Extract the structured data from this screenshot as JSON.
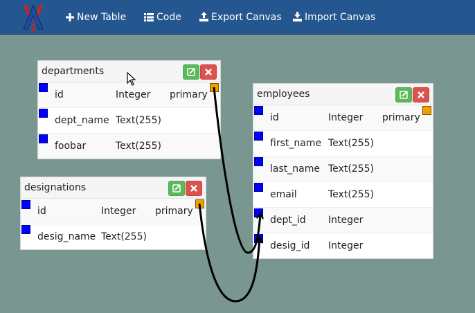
{
  "navbar": {
    "logo_icon": "av-logo-icon",
    "items": [
      {
        "label": "New Table",
        "icon": "plus-icon"
      },
      {
        "label": "Code",
        "icon": "list-icon"
      },
      {
        "label": "Export Canvas",
        "icon": "export-icon"
      },
      {
        "label": "Import Canvas",
        "icon": "import-icon"
      }
    ]
  },
  "tables": {
    "departments": {
      "name": "departments",
      "rows": [
        {
          "field": "id",
          "type": "Integer",
          "key": "primary"
        },
        {
          "field": "dept_name",
          "type": "Text(255)",
          "key": ""
        },
        {
          "field": "foobar",
          "type": "Text(255)",
          "key": ""
        }
      ]
    },
    "employees": {
      "name": "employees",
      "rows": [
        {
          "field": "id",
          "type": "Integer",
          "key": "primary"
        },
        {
          "field": "first_name",
          "type": "Text(255)",
          "key": ""
        },
        {
          "field": "last_name",
          "type": "Text(255)",
          "key": ""
        },
        {
          "field": "email",
          "type": "Text(255)",
          "key": ""
        },
        {
          "field": "dept_id",
          "type": "Integer",
          "key": ""
        },
        {
          "field": "desig_id",
          "type": "Integer",
          "key": ""
        }
      ]
    },
    "designations": {
      "name": "designations",
      "rows": [
        {
          "field": "id",
          "type": "Integer",
          "key": "primary"
        },
        {
          "field": "desig_name",
          "type": "Text(255)",
          "key": ""
        }
      ]
    }
  },
  "relations": [
    {
      "from": "departments.id",
      "to": "employees.dept_id"
    },
    {
      "from": "designations.id",
      "to": "employees.desig_id"
    }
  ],
  "colors": {
    "navbar": "#24578f",
    "canvas": "#7a9690",
    "handle": "#0000ff",
    "primary_key": "#f0a000",
    "edit_button": "#5cb85c",
    "delete_button": "#d9534f"
  }
}
